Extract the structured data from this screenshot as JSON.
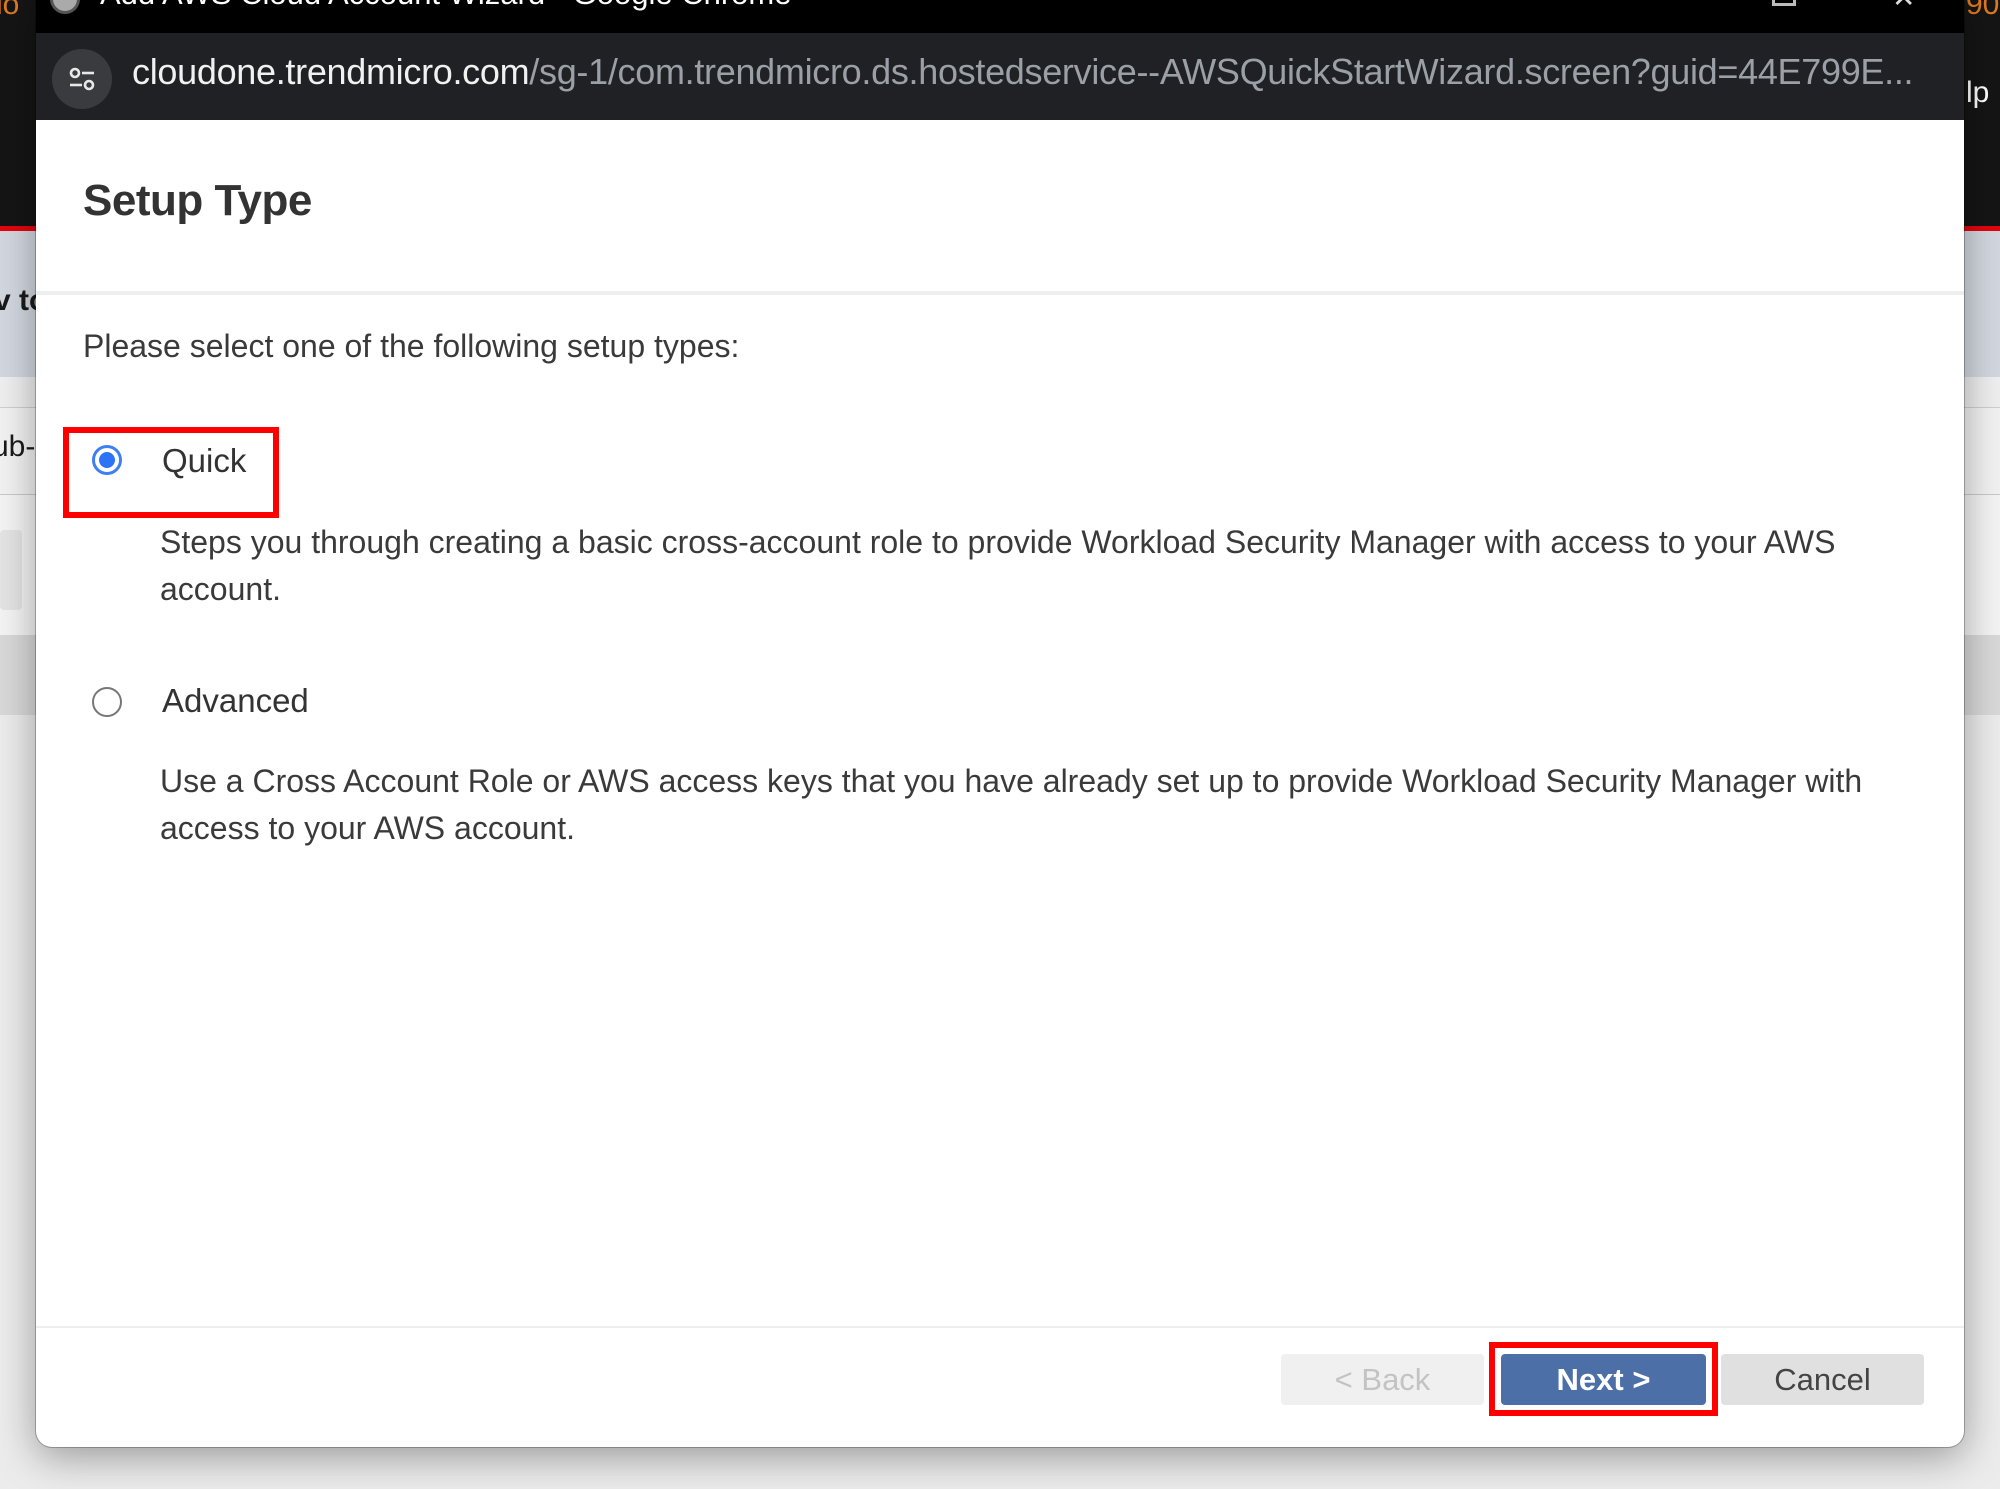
{
  "background_app": {
    "header_fragment_left": "lo",
    "header_fragment_right": "lp",
    "header_fragment_right_top": "90",
    "band_fragment": "v to",
    "row_fragment": "ub-"
  },
  "window": {
    "title": "Add AWS Cloud Account Wizard - Google Chrome",
    "controls": {
      "restore": "restore-icon",
      "close": "✕"
    }
  },
  "address_bar": {
    "site_info_icon": "tune-icon",
    "host": "cloudone.trendmicro.com",
    "path": "/sg-1/com.trendmicro.ds.hostedservice--AWSQuickStartWizard.screen?guid=44E799E..."
  },
  "dialog": {
    "title": "Setup Type",
    "instructions": "Please select one of the following setup types:",
    "options": [
      {
        "label": "Quick",
        "selected": true,
        "description": "Steps you through creating a basic cross-account role to provide Workload Security Manager with access to your AWS account."
      },
      {
        "label": "Advanced",
        "selected": false,
        "description": "Use a Cross Account Role or AWS access keys that you have already set up to provide Workload Security Manager with access to your AWS account."
      }
    ],
    "buttons": {
      "back": "< Back",
      "next": "Next >",
      "cancel": "Cancel"
    },
    "button_states": {
      "back_enabled": false,
      "next_enabled": true,
      "cancel_enabled": true
    }
  },
  "annotations": {
    "highlight_color": "#ff0000",
    "highlighted": [
      "Quick option",
      "Next button"
    ]
  },
  "colors": {
    "primary_button": "#4c6fa8",
    "radio_selected": "#2d73f5",
    "background_accent_red": "#e4050f"
  }
}
